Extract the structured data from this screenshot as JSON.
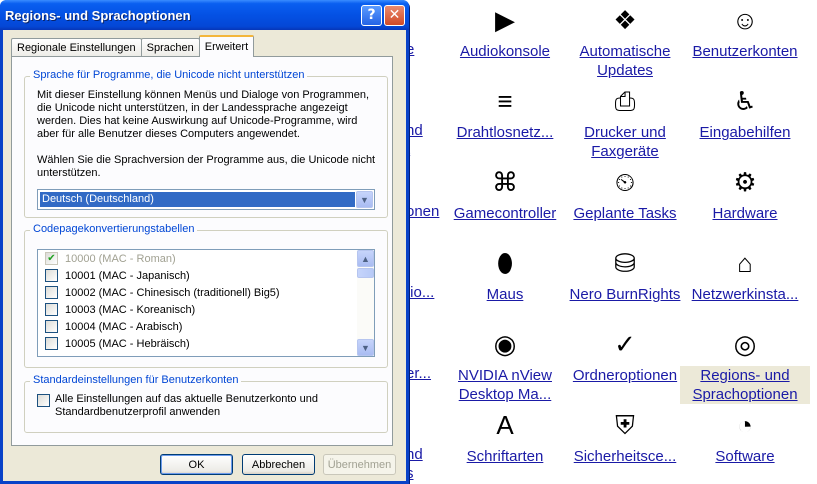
{
  "control_panel": {
    "items": [
      {
        "label": "Audiokonsole",
        "icon": "audio-console-icon",
        "glyph": "▶"
      },
      {
        "label": "Automatische Updates",
        "icon": "windows-update-icon",
        "glyph": "❖"
      },
      {
        "label": "Benutzerkonten",
        "icon": "user-accounts-icon",
        "glyph": "☺"
      },
      {
        "label": "Drahtlosnetz...",
        "icon": "wireless-network-icon",
        "glyph": "≡"
      },
      {
        "label": "Drucker und Faxgeräte",
        "icon": "printer-icon",
        "glyph": "⎙"
      },
      {
        "label": "Eingabehilfen",
        "icon": "accessibility-icon",
        "glyph": "♿"
      },
      {
        "label": "Gamecontroller",
        "icon": "game-controller-icon",
        "glyph": "⌘"
      },
      {
        "label": "Geplante Tasks",
        "icon": "scheduled-tasks-icon",
        "glyph": "⏲"
      },
      {
        "label": "Hardware",
        "icon": "hardware-icon",
        "glyph": "⚙"
      },
      {
        "label": "Maus",
        "icon": "mouse-icon",
        "glyph": "⬮"
      },
      {
        "label": "Nero BurnRights",
        "icon": "nero-burnrights-icon",
        "glyph": "⛁"
      },
      {
        "label": "Netzwerkinsta...",
        "icon": "network-setup-icon",
        "glyph": "⌂"
      },
      {
        "label": "NVIDIA nView Desktop Ma...",
        "icon": "nvidia-icon",
        "glyph": "◉"
      },
      {
        "label": "Ordneroptionen",
        "icon": "folder-options-icon",
        "glyph": "✓"
      },
      {
        "label": "Regions- und Sprachoptionen",
        "icon": "globe-icon",
        "glyph": "◎"
      },
      {
        "label": "Schriftarten",
        "icon": "fonts-icon",
        "glyph": "A"
      },
      {
        "label": "Sicherheitsce...",
        "icon": "security-center-icon",
        "glyph": "⛨"
      },
      {
        "label": "Software",
        "icon": "software-icon",
        "glyph": "◔"
      }
    ],
    "partial_labels": [
      "e",
      "nd",
      "t",
      "onen",
      "tio...",
      "er...",
      "nd",
      "s"
    ]
  },
  "dialog": {
    "title": "Regions- und Sprachoptionen",
    "help_glyph": "?",
    "close_glyph": "✕",
    "tabs": [
      "Regionale Einstellungen",
      "Sprachen",
      "Erweitert"
    ],
    "active_tab": "Erweitert",
    "group_unicode": {
      "title": "Sprache für Programme, die Unicode nicht unterstützen",
      "description": "Mit dieser Einstellung können Menüs und Dialoge von Programmen, die Unicode nicht unterstützen, in der Landessprache angezeigt werden. Dies hat keine Auswirkung auf Unicode-Programme, wird aber für alle Benutzer dieses Computers angewendet.",
      "prompt": "Wählen Sie die Sprachversion der Programme aus, die Unicode nicht unterstützen.",
      "selected_language": "Deutsch (Deutschland)"
    },
    "group_codepage": {
      "title": "Codepagekonvertierungstabellen",
      "rows": [
        {
          "label": "10000 (MAC - Roman)",
          "checked": true,
          "disabled": true
        },
        {
          "label": "10001 (MAC - Japanisch)",
          "checked": false,
          "disabled": false
        },
        {
          "label": "10002 (MAC - Chinesisch (traditionell) Big5)",
          "checked": false,
          "disabled": false
        },
        {
          "label": "10003 (MAC - Koreanisch)",
          "checked": false,
          "disabled": false
        },
        {
          "label": "10004 (MAC - Arabisch)",
          "checked": false,
          "disabled": false
        },
        {
          "label": "10005 (MAC - Hebräisch)",
          "checked": false,
          "disabled": false
        }
      ]
    },
    "group_defaults": {
      "title": "Standardeinstellungen für Benutzerkonten",
      "option_label": "Alle Einstellungen auf das aktuelle Benutzerkonto und Standardbenutzerprofil anwenden",
      "option_checked": false
    },
    "buttons": {
      "ok": "OK",
      "cancel": "Abbrechen",
      "apply": "Übernehmen"
    }
  },
  "colors": {
    "title_bar": "#0451e4",
    "group_title": "#0046d5",
    "link": "#1a1aa6",
    "selection": "#316ac5"
  }
}
